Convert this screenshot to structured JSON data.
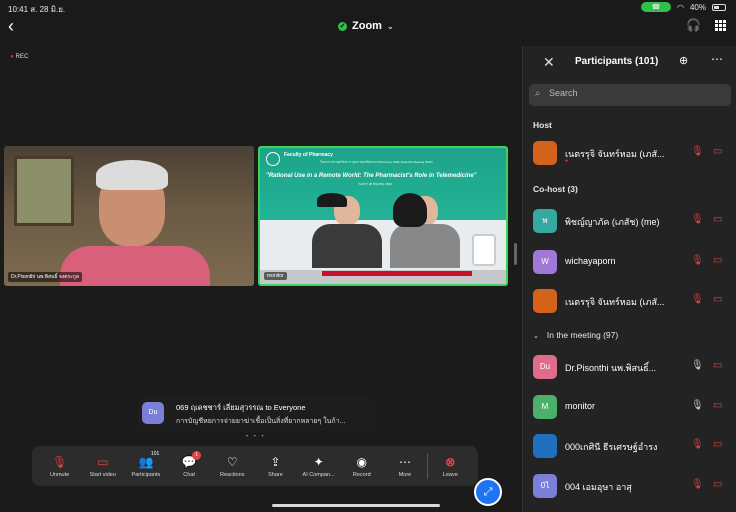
{
  "status_bar": {
    "time": "10:41",
    "date": "ส. 28 มิ.ย.",
    "call_pill": "☎",
    "battery": "40%"
  },
  "top_bar": {
    "app_title": "Zoom",
    "rec_label": "REC"
  },
  "tiles": [
    {
      "label": "Dr.Pisonthi นพ.พิสนธิ์ จงตระกูล"
    },
    {
      "label": "monitor",
      "slide_faculty": "Faculty of Pharmacy",
      "slide_event": "โครงการประชุมวิชาการ คุณภาพเภสัชกรรม (Pharmacy Skills Scientific Meeting 2025)",
      "slide_title": "\"Rational Use in a Remote World: The Pharmacist's Role in Telemedicine\"",
      "slide_date": "วันเสาร์ 28 มิถุนายน 2568"
    }
  ],
  "chat": {
    "avatar": "Du",
    "sender": "069 ฤเดชชาร์ เลี่ยมสุวรรณ to Everyone",
    "message": "การบัญชีหยการจ่ายยาฆ่าเชื้อเป็นสิ่งที่ยากหลายๆ ในก้า..."
  },
  "toolbar": {
    "unmute": "Unmute",
    "start_video": "Start video",
    "participants": "Participants",
    "participants_count": "101",
    "chat": "Chat",
    "chat_badge": "1",
    "reactions": "Reactions",
    "share": "Share",
    "ai": "AI Compan...",
    "record": "Record",
    "more": "More",
    "leave": "Leave"
  },
  "panel": {
    "title": "Participants (101)",
    "search_placeholder": "Search",
    "host_label": "Host",
    "cohost_label": "Co-host (3)",
    "meeting_label": "In the meeting (97)",
    "host": {
      "name": "เนตรรุจิ จันทร์หอม (เภสั...",
      "avatar": ""
    },
    "cohosts": [
      {
        "name": "พิชญ์ญาภัค (เภสัช) (me)",
        "avatar": "พ",
        "color": "#35a8a0"
      },
      {
        "name": "wichayaporn",
        "avatar": "W",
        "color": "#a078d8"
      },
      {
        "name": "เนตรรุจิ จันทร์หอม (เภสั...",
        "avatar": "",
        "color": "#d4621a"
      }
    ],
    "members": [
      {
        "name": "Dr.Pisonthi นพ.พิสนธิ์...",
        "avatar": "Du",
        "color": "#e06c8b"
      },
      {
        "name": "monitor",
        "avatar": "M",
        "color": "#4caf6a"
      },
      {
        "name": "000เกศินี ธีรเศรษฐ์อำรง",
        "avatar": "",
        "color": "#1f6fbf"
      },
      {
        "name": "004 เอมอุษา อาสุ",
        "avatar": "0ไ",
        "color": "#7b7fd8"
      }
    ]
  },
  "colors": {
    "accent": "#2fbf4a",
    "danger": "#e54242",
    "link": "#1d74f5"
  }
}
